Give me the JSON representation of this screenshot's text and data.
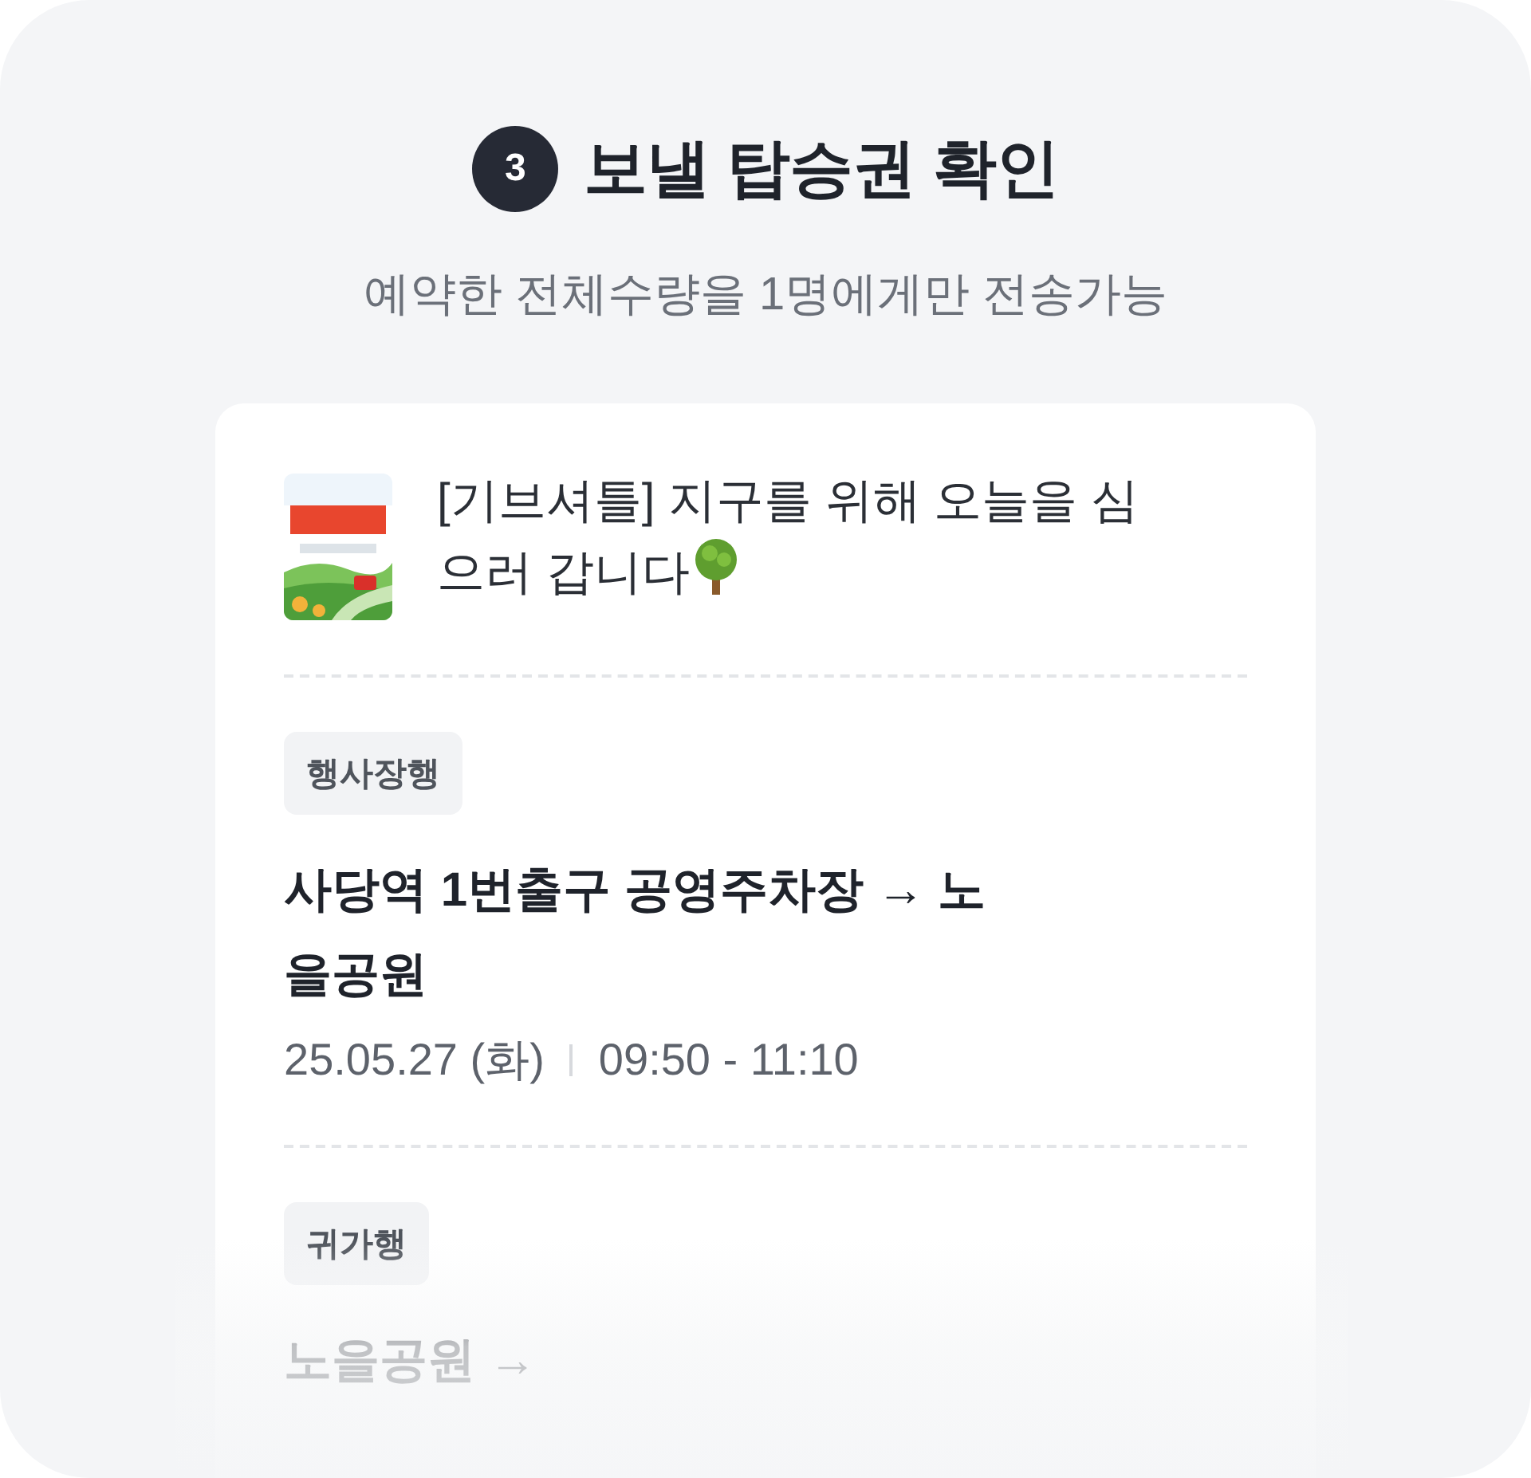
{
  "step": {
    "number": "3",
    "title": "보낼 탑승권 확인",
    "subtitle": "예약한 전체수량을 1명에게만 전송가능"
  },
  "event": {
    "title": "[기브셔틀] 지구를 위해 오늘을 심으러 갑니다"
  },
  "trips": [
    {
      "tag": "행사장행",
      "route": "사당역 1번출구 공영주차장 → 노을공원",
      "date": "25.05.27 (화)",
      "time": "09:50 - 11:10"
    },
    {
      "tag": "귀가행",
      "route": "노을공원 →"
    }
  ]
}
